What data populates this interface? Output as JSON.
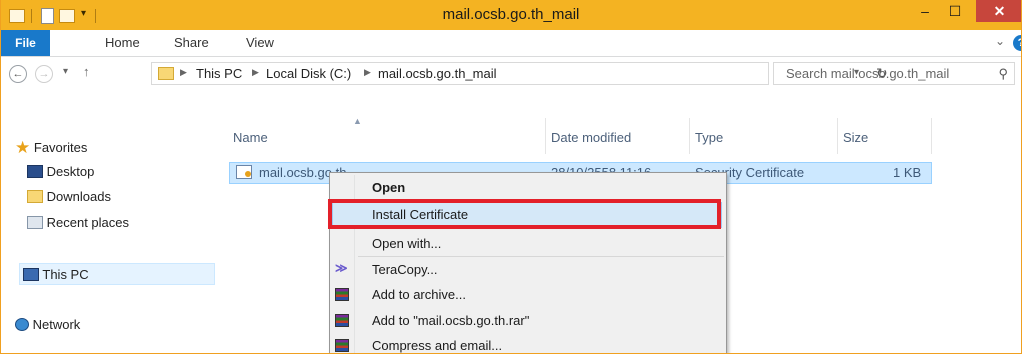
{
  "window": {
    "title": "mail.ocsb.go.th_mail"
  },
  "controls": {
    "minimize": "–",
    "maximize": "☐",
    "close": "✕"
  },
  "ribbon": {
    "tabs": [
      "File",
      "Home",
      "Share",
      "View"
    ],
    "help": "?"
  },
  "address": {
    "crumbs": [
      "This PC",
      "Local Disk (C:)",
      "mail.ocsb.go.th_mail"
    ],
    "search_placeholder": "Search mail.ocsb.go.th_mail"
  },
  "nav": {
    "favorites": "Favorites",
    "desktop": "Desktop",
    "downloads": "Downloads",
    "recent": "Recent places",
    "thispc": "This PC",
    "network": "Network"
  },
  "columns": {
    "name": "Name",
    "date": "Date modified",
    "type": "Type",
    "size": "Size"
  },
  "file": {
    "name": "mail.ocsb.go.th",
    "date": "28/10/2558 11:16",
    "type": "Security Certificate",
    "size": "1 KB"
  },
  "context_menu": {
    "open": "Open",
    "install": "Install Certificate",
    "open_with": "Open with...",
    "teracopy": "TeraCopy...",
    "add_archive": "Add to archive...",
    "add_rar": "Add to \"mail.ocsb.go.th.rar\"",
    "compress_email": "Compress and email..."
  },
  "colors": {
    "titlebar": "#f4b322",
    "file_tab": "#1979ca",
    "selection": "#cce8ff",
    "highlight_box": "#e3202a"
  }
}
